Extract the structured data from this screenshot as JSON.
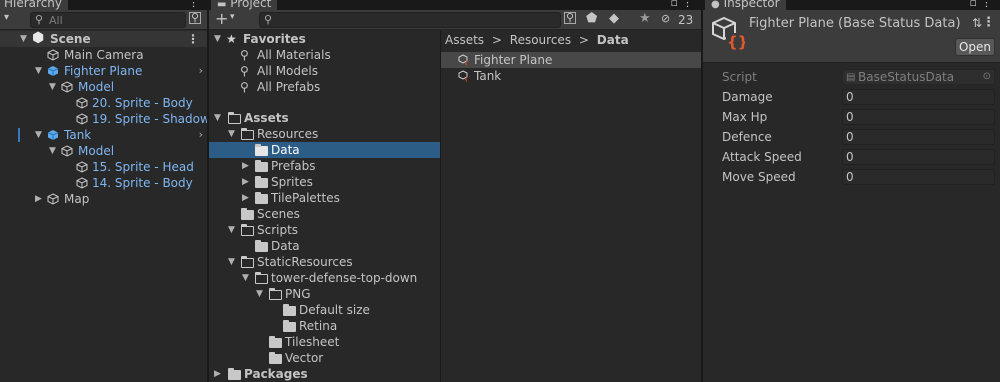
{
  "hierarchy": {
    "tab_title": "Hierarchy",
    "search_placeholder": "All",
    "scene": {
      "name": "Scene"
    },
    "items": [
      {
        "label": "Main Camera"
      },
      {
        "label": "Fighter Plane"
      },
      {
        "label": "Model"
      },
      {
        "label": "20. Sprite - Body"
      },
      {
        "label": "19. Sprite - Shadow"
      },
      {
        "label": "Tank"
      },
      {
        "label": "Model"
      },
      {
        "label": "15. Sprite - Head"
      },
      {
        "label": "14. Sprite - Body"
      },
      {
        "label": "Map"
      }
    ]
  },
  "project": {
    "tab_title": "Project",
    "hidden_count": "23",
    "favorites": {
      "label": "Favorites",
      "items": [
        {
          "label": "All Materials"
        },
        {
          "label": "All Models"
        },
        {
          "label": "All Prefabs"
        }
      ]
    },
    "tree": [
      {
        "label": "Assets"
      },
      {
        "label": "Resources"
      },
      {
        "label": "Data"
      },
      {
        "label": "Prefabs"
      },
      {
        "label": "Sprites"
      },
      {
        "label": "TilePalettes"
      },
      {
        "label": "Scenes"
      },
      {
        "label": "Scripts"
      },
      {
        "label": "Data"
      },
      {
        "label": "StaticResources"
      },
      {
        "label": "tower-defense-top-down"
      },
      {
        "label": "PNG"
      },
      {
        "label": "Default size"
      },
      {
        "label": "Retina"
      },
      {
        "label": "Tilesheet"
      },
      {
        "label": "Vector"
      },
      {
        "label": "Packages"
      }
    ],
    "breadcrumb": {
      "assets": "Assets",
      "resources": "Resources",
      "data": "Data",
      "sep": ">"
    },
    "files": [
      {
        "label": "Fighter Plane"
      },
      {
        "label": "Tank"
      }
    ]
  },
  "inspector": {
    "tab_title": "Inspector",
    "object_title": "Fighter Plane (Base Status Data)",
    "open_label": "Open",
    "script_label": "Script",
    "script_value": "BaseStatusData",
    "fields": [
      {
        "label": "Damage",
        "value": "0"
      },
      {
        "label": "Max Hp",
        "value": "0"
      },
      {
        "label": "Defence",
        "value": "0"
      },
      {
        "label": "Attack Speed",
        "value": "0"
      },
      {
        "label": "Move Speed",
        "value": "0"
      }
    ]
  },
  "colors": {
    "selection": "#2c5d87",
    "accent": "#3a79bb",
    "link_blue": "#7fb6f2",
    "script_orange": "#e2572c"
  }
}
